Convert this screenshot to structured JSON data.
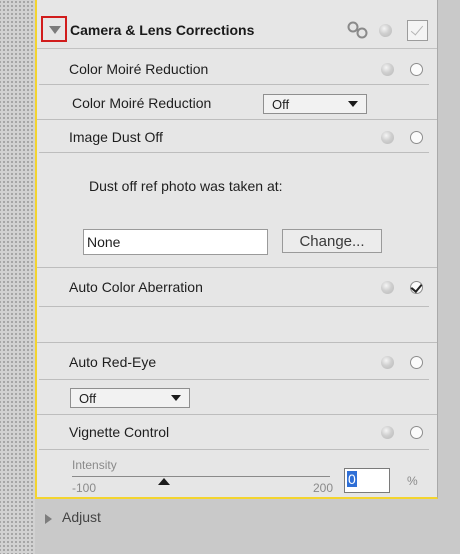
{
  "panel": {
    "title": "Camera & Lens Corrections",
    "enabled_checked": true
  },
  "color_moire": {
    "header_label": "Color Moiré Reduction",
    "field_label": "Color Moiré Reduction",
    "selected": "Off"
  },
  "image_dust_off": {
    "label": "Image Dust Off",
    "ref_text": "Dust off ref photo was taken at:",
    "field_value": "None",
    "change_button": "Change..."
  },
  "auto_color_aberration": {
    "label": "Auto Color Aberration",
    "checked": true
  },
  "auto_red_eye": {
    "label": "Auto Red-Eye",
    "selected": "Off"
  },
  "vignette": {
    "label": "Vignette Control",
    "slider_label": "Intensity",
    "min_label": "-100",
    "max_label": "200",
    "value": "0",
    "unit": "%"
  },
  "adjust": {
    "label": "Adjust"
  },
  "colors": {
    "panel_bg": "#e6e6e6",
    "accent_border": "#f3d42f",
    "highlight_box": "#d11c1c",
    "selection": "#2f6fd6"
  }
}
